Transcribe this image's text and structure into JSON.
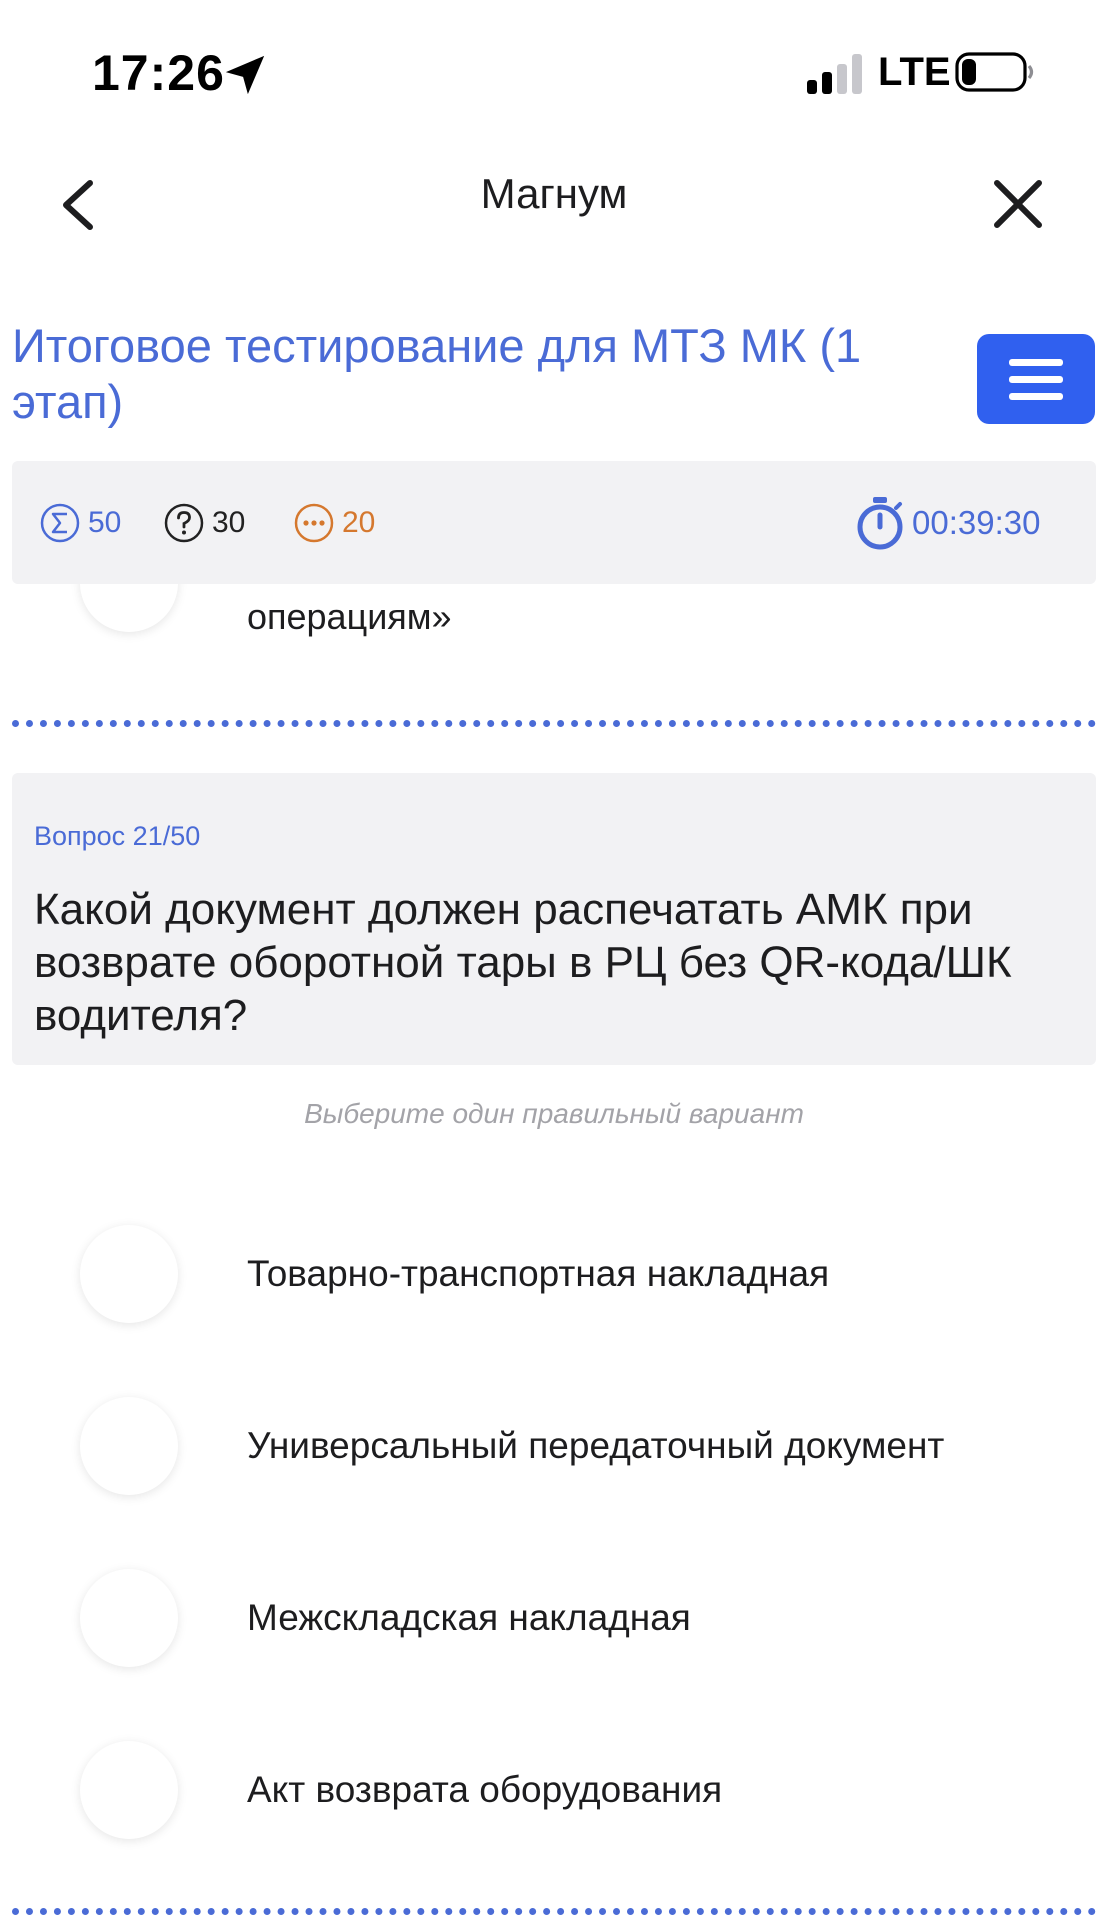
{
  "status_bar": {
    "time": "17:26",
    "network": "LTE"
  },
  "nav": {
    "title": "Магнум"
  },
  "test": {
    "title": " Итоговое тестирование для МТЗ МК (1 этап)"
  },
  "stats": {
    "total": "50",
    "questions": "30",
    "skipped": "20",
    "timer": "00:39:30"
  },
  "previous_question": {
    "tail_text": "операциям»"
  },
  "question": {
    "counter": "Вопрос 21/50",
    "text": "Какой документ должен распечатать АМК при возврате оборотной тары в РЦ без QR-кода/ШК водителя?",
    "hint": "Выберите один правильный вариант",
    "options": [
      {
        "label": "Товарно-транспортная накладная"
      },
      {
        "label": "Универсальный передаточный документ"
      },
      {
        "label": "Межскладская накладная"
      },
      {
        "label": "Акт возврата оборудования"
      }
    ]
  },
  "colors": {
    "accent": "#4a6bd6",
    "menu_button": "#3060ef",
    "skipped": "#d5782e",
    "card_background": "#f2f2f4"
  },
  "icons": {
    "location": "location-arrow-icon",
    "signal": "cellular-signal-icon",
    "battery": "battery-icon",
    "back": "chevron-left-icon",
    "close": "close-icon",
    "menu": "hamburger-menu-icon",
    "total": "sigma-icon",
    "questions": "question-circle-icon",
    "skipped": "ellipsis-circle-icon",
    "timer": "stopwatch-icon"
  }
}
